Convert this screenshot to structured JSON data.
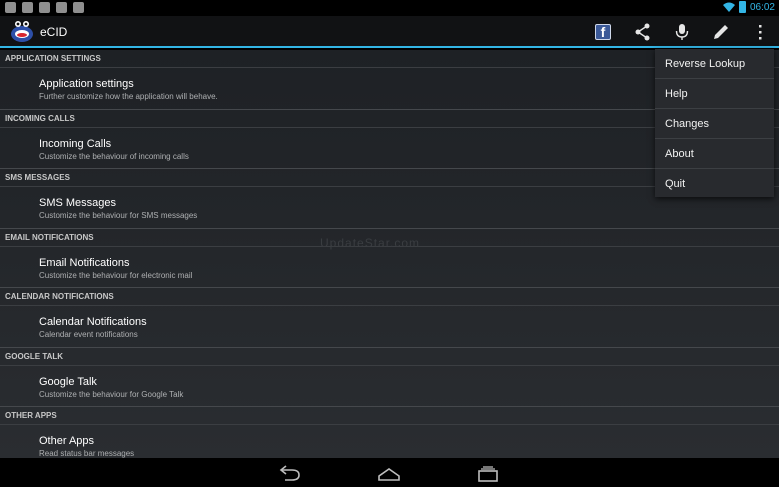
{
  "status_bar": {
    "notification_icons": [
      "app-icon",
      "mail-icon",
      "gmail-icon",
      "cat-icon",
      "briefcase-icon"
    ],
    "time": "06:02"
  },
  "action_bar": {
    "title": "eCID",
    "actions": [
      "facebook-icon",
      "share-icon",
      "microphone-icon",
      "pencil-icon",
      "overflow-icon"
    ],
    "accent_color": "#33b5e5"
  },
  "sections": [
    {
      "header": "APPLICATION SETTINGS",
      "title": "Application settings",
      "summary": "Further customize how the application will behave."
    },
    {
      "header": "INCOMING CALLS",
      "title": "Incoming Calls",
      "summary": "Customize the behaviour of incoming calls"
    },
    {
      "header": "SMS MESSAGES",
      "title": "SMS Messages",
      "summary": "Customize the behaviour for SMS messages"
    },
    {
      "header": "EMAIL NOTIFICATIONS",
      "title": "Email Notifications",
      "summary": "Customize the behaviour for electronic mail"
    },
    {
      "header": "CALENDAR NOTIFICATIONS",
      "title": "Calendar Notifications",
      "summary": "Calendar event notifications"
    },
    {
      "header": "GOOGLE TALK",
      "title": "Google Talk",
      "summary": "Customize the behaviour for Google Talk"
    },
    {
      "header": "OTHER APPS",
      "title": "Other Apps",
      "summary": "Read status bar messages"
    }
  ],
  "watermark": "UpdateStar.com",
  "menu": {
    "items": [
      "Reverse Lookup",
      "Help",
      "Changes",
      "About",
      "Quit"
    ]
  },
  "nav_bar": [
    "back-icon",
    "home-icon",
    "recents-icon"
  ]
}
